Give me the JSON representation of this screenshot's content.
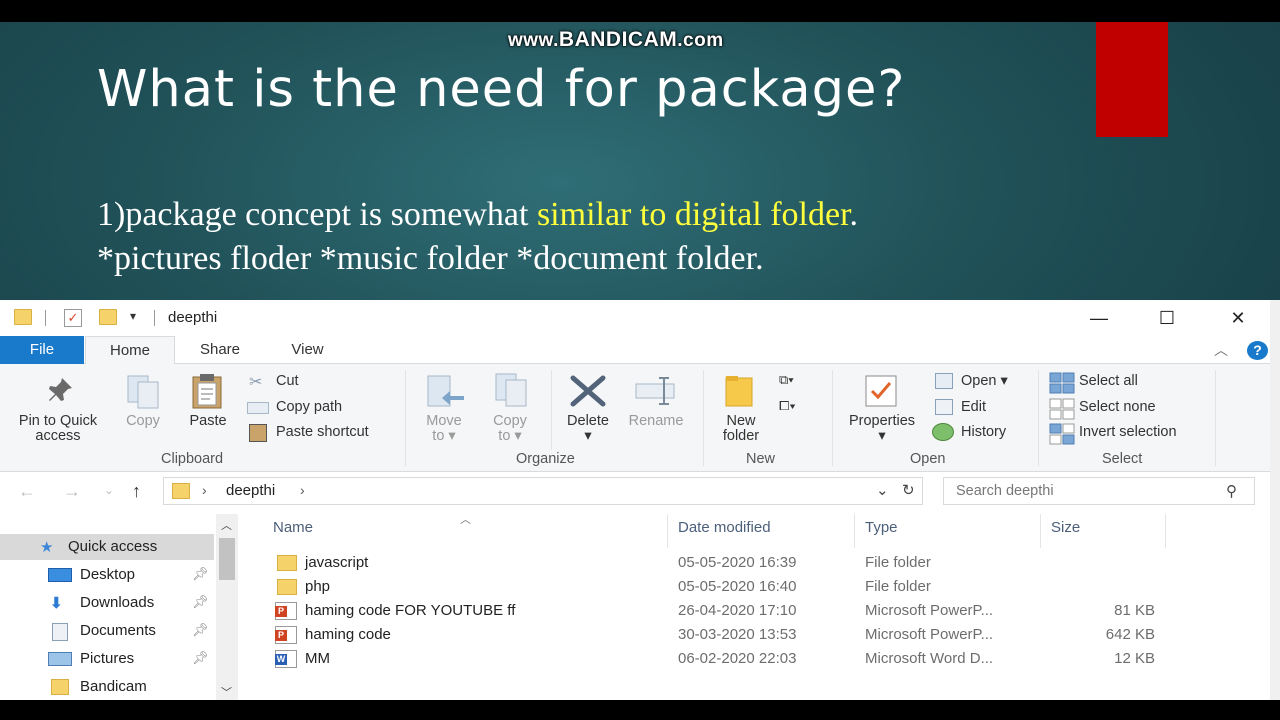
{
  "watermark": {
    "prefix": "www.",
    "brand": "BANDICAM",
    "suffix": ".com"
  },
  "slide": {
    "title": "What is the need for package?",
    "line1_pre": "1)package concept is somewhat ",
    "line1_highlight": "similar to digital folder",
    "line1_post": ".",
    "line2": "*pictures floder *music folder *document folder.",
    "highlight_color": "#ffff3c"
  },
  "window": {
    "title": "deepthi",
    "minimize": "—",
    "maximize": "☐",
    "close": "✕",
    "help": "?"
  },
  "tabs": [
    "File",
    "Home",
    "Share",
    "View"
  ],
  "ribbon": {
    "clipboard": {
      "pin": "Pin to Quick",
      "pin2": "access",
      "copy": "Copy",
      "paste": "Paste",
      "cut": "Cut",
      "copy_path": "Copy path",
      "paste_shortcut": "Paste shortcut",
      "group": "Clipboard"
    },
    "organize": {
      "move": "Move",
      "move2": "to",
      "copy": "Copy",
      "copy2": "to",
      "delete": "Delete",
      "rename": "Rename",
      "group": "Organize"
    },
    "new": {
      "new1": "New",
      "new2": "folder",
      "group": "New"
    },
    "open": {
      "properties": "Properties",
      "open": "Open",
      "edit": "Edit",
      "history": "History",
      "group": "Open"
    },
    "select": {
      "all": "Select all",
      "none": "Select none",
      "invert": "Invert selection",
      "group": "Select"
    }
  },
  "nav": {
    "path": "deepthi",
    "search_placeholder": "Search deepthi"
  },
  "sidebar": {
    "items": [
      {
        "label": "Quick access",
        "icon": "star-icon"
      },
      {
        "label": "Desktop",
        "icon": "desktop-icon"
      },
      {
        "label": "Downloads",
        "icon": "download-icon"
      },
      {
        "label": "Documents",
        "icon": "documents-icon"
      },
      {
        "label": "Pictures",
        "icon": "pictures-icon"
      },
      {
        "label": "Bandicam",
        "icon": "folder-icon"
      }
    ]
  },
  "columns": {
    "name": "Name",
    "date": "Date modified",
    "type": "Type",
    "size": "Size"
  },
  "files": [
    {
      "name": "javascript",
      "date": "05-05-2020 16:39",
      "type": "File folder",
      "size": "",
      "icon": "folder-icon"
    },
    {
      "name": "php",
      "date": "05-05-2020 16:40",
      "type": "File folder",
      "size": "",
      "icon": "folder-icon"
    },
    {
      "name": "haming code FOR YOUTUBE ff",
      "date": "26-04-2020 17:10",
      "type": "Microsoft PowerP...",
      "size": "81 KB",
      "icon": "powerpoint-icon"
    },
    {
      "name": "haming code",
      "date": "30-03-2020 13:53",
      "type": "Microsoft PowerP...",
      "size": "642 KB",
      "icon": "powerpoint-icon"
    },
    {
      "name": "MM",
      "date": "06-02-2020 22:03",
      "type": "Microsoft Word D...",
      "size": "12 KB",
      "icon": "word-icon"
    }
  ]
}
